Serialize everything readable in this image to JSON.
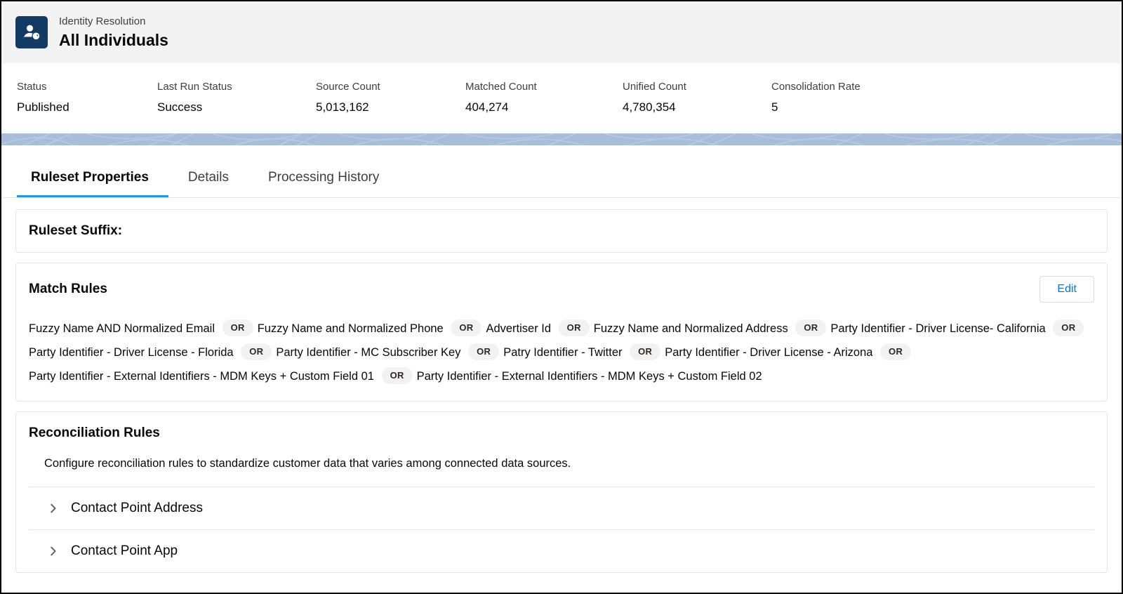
{
  "header": {
    "icon": "identity-person-badge-icon",
    "eyebrow": "Identity Resolution",
    "title": "All Individuals",
    "icon_bg": "#123a63"
  },
  "stats": [
    {
      "label": "Status",
      "value": "Published"
    },
    {
      "label": "Last Run Status",
      "value": "Success"
    },
    {
      "label": "Source Count",
      "value": "5,013,162"
    },
    {
      "label": "Matched Count",
      "value": "404,274"
    },
    {
      "label": "Unified Count",
      "value": "4,780,354"
    },
    {
      "label": "Consolidation Rate",
      "value": "5"
    }
  ],
  "banner": {
    "color": "#a7bdd9"
  },
  "tabs": [
    {
      "label": "Ruleset Properties",
      "active": true
    },
    {
      "label": "Details",
      "active": false
    },
    {
      "label": "Processing History",
      "active": false
    }
  ],
  "tab_accent": "#1b96ff",
  "ruleset_suffix": {
    "title": "Ruleset Suffix:",
    "value": ""
  },
  "match_rules": {
    "title": "Match Rules",
    "edit_label": "Edit",
    "separator": "OR",
    "rules": [
      "Fuzzy Name AND Normalized Email",
      "Fuzzy Name and Normalized Phone",
      "Advertiser Id",
      "Fuzzy Name and Normalized Address",
      "Party Identifier - Driver License- California",
      "Party Identifier - Driver License - Florida",
      "Party Identifier - MC Subscriber Key",
      "Patry Identifier - Twitter",
      "Party Identifier - Driver License - Arizona",
      "Party Identifier - External Identifiers - MDM Keys + Custom Field 01",
      "Party Identifier - External Identifiers - MDM Keys + Custom Field 02"
    ]
  },
  "reconciliation_rules": {
    "title": "Reconciliation Rules",
    "description": "Configure reconciliation rules to standardize customer data that varies among connected data sources.",
    "items": [
      {
        "label": "Contact Point Address",
        "expanded": false
      },
      {
        "label": "Contact Point App",
        "expanded": false
      }
    ]
  }
}
